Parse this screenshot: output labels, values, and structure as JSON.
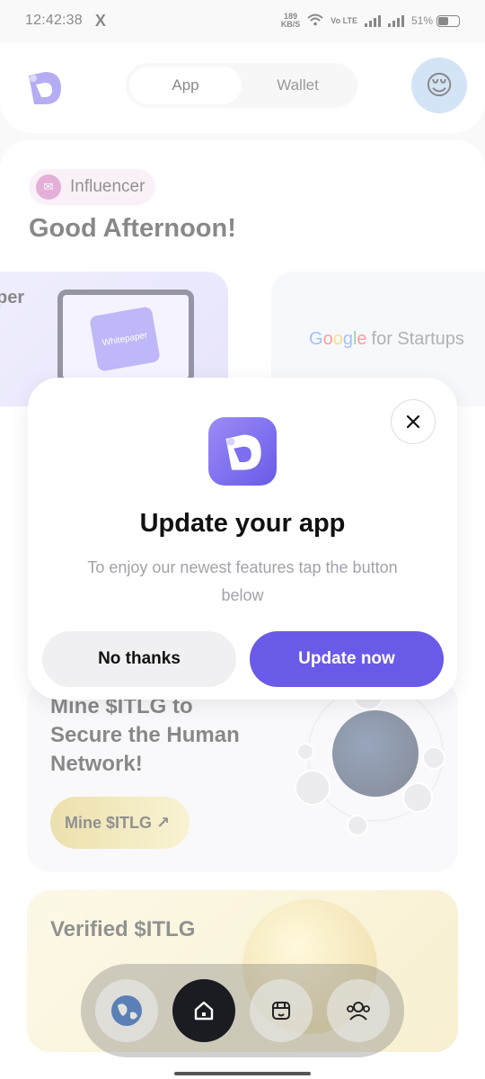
{
  "status_bar": {
    "time": "12:42:38",
    "x_app": "X",
    "net_speed": "189",
    "net_unit": "KB/S",
    "volte": "Vo LTE",
    "battery": "51%"
  },
  "header": {
    "tabs": [
      {
        "label": "App",
        "active": true
      },
      {
        "label": "Wallet",
        "active": false
      }
    ],
    "avatar_emoji": "😌"
  },
  "home": {
    "badge": "Influencer",
    "greeting": "Good Afternoon!",
    "banner1_text": "per",
    "banner1_doc": "Whitepaper",
    "banner2": {
      "g": "G",
      "o1": "o",
      "o2": "o",
      "g2": "g",
      "l": "l",
      "e": "e",
      "suffix": "for Startups"
    },
    "mine_title": "Mine $ITLG to Secure the Human Network!",
    "mine_button": "Mine $ITLG ↗",
    "verified_title": "Verified $ITLG"
  },
  "modal": {
    "title": "Update your app",
    "description": "To enjoy our newest features tap the button below",
    "secondary_button": "No thanks",
    "primary_button": "Update now"
  },
  "colors": {
    "accent": "#6a5ae8",
    "badge_bg": "#f5e3f0",
    "nav_active": "#1b1c22"
  }
}
